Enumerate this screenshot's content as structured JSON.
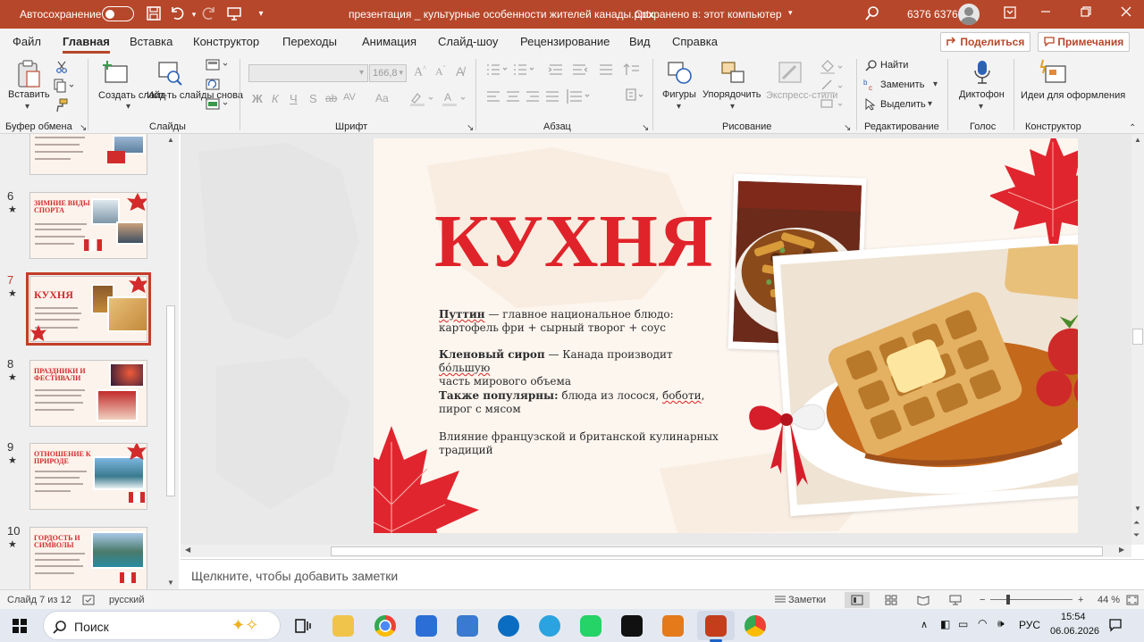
{
  "titlebar": {
    "autosave_label": "Автосохранение",
    "doc_title": "презентация _ культурные особенности жителей канады.pptx",
    "saved_status": "Сохранено в: этот компьютер",
    "user_name": "6376 6376",
    "accent": "#b7472a"
  },
  "tabs": [
    "Файл",
    "Главная",
    "Вставка",
    "Конструктор",
    "Переходы",
    "Анимация",
    "Слайд-шоу",
    "Рецензирование",
    "Вид",
    "Справка"
  ],
  "tab_actions": {
    "share": "Поделиться",
    "comments": "Примечания"
  },
  "ribbon": {
    "paste": "Вставить",
    "new_slide": "Создать слайд",
    "reuse_slides": "Исп-ть слайды снова",
    "font_size": "166,8",
    "find": "Найти",
    "replace": "Заменить",
    "select": "Выделить",
    "shapes": "Фигуры",
    "arrange": "Упорядочить",
    "quick_styles": "Экспресс-стили",
    "dictate": "Диктофон",
    "designer": "Идеи для оформления",
    "groups": [
      "Буфер обмена",
      "Слайды",
      "Шрифт",
      "Абзац",
      "Рисование",
      "Редактирование",
      "Голос",
      "Конструктор"
    ],
    "font_buttons": [
      "Ж",
      "К",
      "Ч",
      "S",
      "ab",
      "AV",
      "Aa"
    ]
  },
  "thumbnails": [
    {
      "num": "6",
      "title": "ЗИМНИЕ ВИДЫ СПОРТА"
    },
    {
      "num": "7",
      "title": "КУХНЯ"
    },
    {
      "num": "8",
      "title": "ПРАЗДНИКИ И ФЕСТИВАЛИ"
    },
    {
      "num": "9",
      "title": "ОТНОШЕНИЕ К ПРИРОДЕ"
    },
    {
      "num": "10",
      "title": "ГОРДОСТЬ И СИМВОЛЫ"
    }
  ],
  "thumb_star": "★",
  "slide": {
    "title": "КУХНЯ",
    "p1_bold": "Путтин",
    "p1_dash": " — главное национальное блюдо:",
    "p1_line2": "картофель фри + сырный творог + соус",
    "p2_bold": "Кленовый сироп",
    "p2_rest_a": " — Канада производит ",
    "p2_squig": "бо́льшую",
    "p2_line2": "часть мирового объема",
    "p3_bold": "Также популярны:",
    "p3_rest_a": " блюда из лосося, ",
    "p3_squig": "боботи",
    "p3_rest_b": ",",
    "p3_line2": "пирог с мясом",
    "p4": "Влияние французской и британской кулинарных традиций"
  },
  "notes_placeholder": "Щелкните, чтобы добавить заметки",
  "status": {
    "slide_counter": "Слайд 7 из 12",
    "language": "русский",
    "notes": "Заметки",
    "zoom": "44 %"
  },
  "taskbar": {
    "search": "Поиск",
    "lang": "РУС",
    "time": "15:54",
    "date": "06.06.2026"
  }
}
